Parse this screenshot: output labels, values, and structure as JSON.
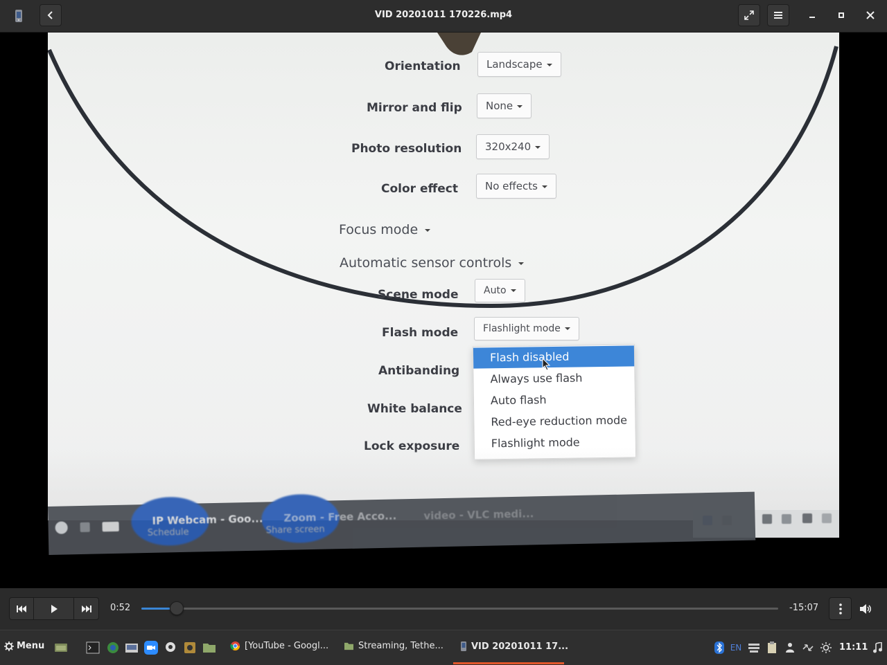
{
  "window": {
    "title": "VID 20201011 170226.mp4",
    "app_icon": "video-player-icon",
    "back_icon": "back-arrow-icon",
    "fullscreen_icon": "fullscreen-icon",
    "menu_icon": "hamburger-menu-icon",
    "minimize_icon": "minimize-icon",
    "maximize_icon": "maximize-icon",
    "close_icon": "close-icon"
  },
  "video_frame": {
    "settings": [
      {
        "label": "Orientation",
        "value": "Landscape"
      },
      {
        "label": "Mirror and flip",
        "value": "None"
      },
      {
        "label": "Photo resolution",
        "value": "320x240"
      },
      {
        "label": "Color effect",
        "value": "No effects"
      }
    ],
    "focus_mode": "Focus mode",
    "automatic_sensor_controls": "Automatic sensor controls",
    "scene_mode": {
      "label": "Scene mode",
      "value": "Auto"
    },
    "flash_mode": {
      "label": "Flash mode",
      "value": "Flashlight mode"
    },
    "antibanding": "Antibanding",
    "white_balance": "White balance",
    "lock_exposure": "Lock exposure",
    "flash_options": [
      "Flash disabled",
      "Always use flash",
      "Auto flash",
      "Red-eye reduction mode",
      "Flashlight mode"
    ],
    "flash_selected": "Flash disabled",
    "taskbar": {
      "task1": "IP Webcam - Goo...",
      "task1_sub": "Schedule",
      "task2": "Zoom - Free Acco...",
      "task2_sub": "Share screen",
      "task3": "video - VLC medi..."
    }
  },
  "controls": {
    "current_time": "0:52",
    "remaining_time": "-15:07",
    "progress_fraction": 0.054,
    "prev_icon": "skip-previous-icon",
    "play_icon": "play-icon",
    "next_icon": "skip-next-icon",
    "more_icon": "more-vertical-icon",
    "volume_icon": "volume-icon"
  },
  "taskbar": {
    "menu_label": "Menu",
    "tasks": [
      {
        "label": "[YouTube - Googl...",
        "icon": "chrome-icon"
      },
      {
        "label": "Streaming, Tethe...",
        "icon": "folder-icon"
      },
      {
        "label": "VID 20201011 17...",
        "icon": "video-player-icon",
        "active": true
      }
    ],
    "language": "EN",
    "clock": "11:11",
    "accent": "#e2572b"
  }
}
